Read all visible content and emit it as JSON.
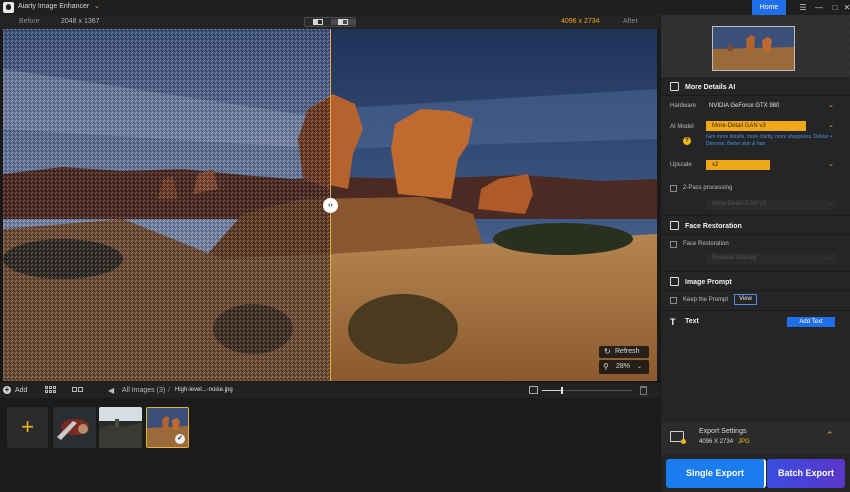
{
  "app": {
    "title": "Aiarty Image Enhancer",
    "home_label": "Home"
  },
  "compare": {
    "before_label": "Before",
    "before_size": "2048 x 1367",
    "after_size": "4096 x 2734",
    "after_label": "After"
  },
  "viewport": {
    "refresh_label": "Refresh",
    "zoom": "28%"
  },
  "toolbar": {
    "add_label": "Add",
    "all_images": "All Images (3)",
    "separator": "/",
    "file_name": "High-level...-noise.jpg",
    "zoom_slider_level": 0.22
  },
  "thumbnails": {
    "count": 3,
    "selected_index": 2
  },
  "panel": {
    "more_details": {
      "title": "More Details AI",
      "hardware_label": "Hardware",
      "hardware_value": "NVIDIA GeForce GTX 980",
      "ai_model_label": "AI Model",
      "ai_model_value": "More-Detail GAN v3",
      "ai_model_desc": "Gen more details, more clarity, more sharpness. Deblur + Denoise. Better skin & hair.",
      "upscale_label": "Upscale",
      "upscale_value": "x2",
      "two_pass_label": "2-Pass processing",
      "two_pass_model": "More-Detail GAN v3"
    },
    "face_restoration": {
      "title": "Face Restoration",
      "checkbox_label": "Face Restoration",
      "mode_value": "Realistic Overlay"
    },
    "image_prompt": {
      "title": "Image Prompt",
      "checkbox_label": "Keep the Prompt",
      "view_label": "View"
    },
    "text": {
      "title": "Text",
      "add_text_label": "Add Text"
    },
    "export": {
      "settings_title": "Export Settings",
      "size": "4096 X 2734",
      "format": "JPG",
      "single_export_label": "Single Export",
      "batch_export_label": "Batch Export"
    }
  },
  "colors": {
    "accent": "#f0a818",
    "primary_blue": "#1f6feb",
    "batch_purple": "#5a36c9"
  }
}
